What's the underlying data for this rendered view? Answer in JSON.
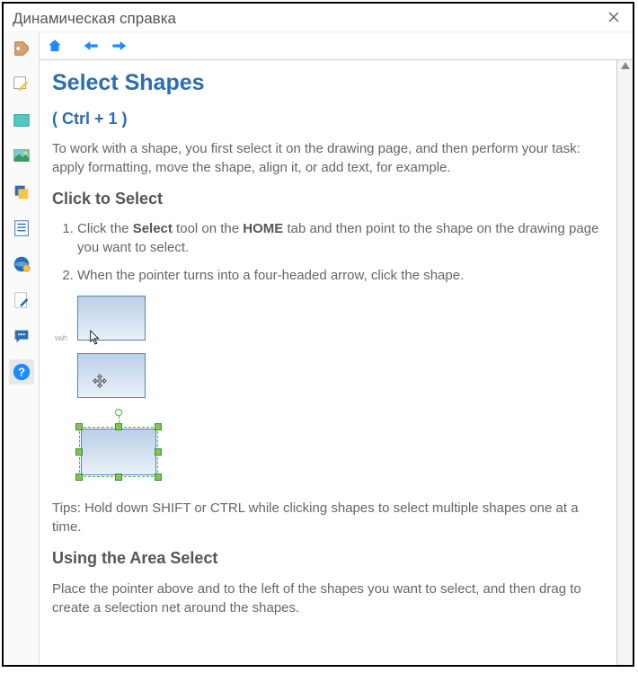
{
  "window": {
    "title": "Динамическая справка"
  },
  "sidebar": {
    "items": [
      {
        "name": "tag-icon"
      },
      {
        "name": "edit-icon"
      },
      {
        "name": "shape-icon"
      },
      {
        "name": "image-icon"
      },
      {
        "name": "layers-icon"
      },
      {
        "name": "list-icon"
      },
      {
        "name": "globe-icon"
      },
      {
        "name": "page-edit-icon"
      },
      {
        "name": "chat-icon"
      },
      {
        "name": "help-icon"
      }
    ]
  },
  "toolbar": {
    "home": "home",
    "back": "back",
    "forward": "forward"
  },
  "topic": {
    "title": "Select Shapes",
    "shortcut": "( Ctrl + 1 )",
    "intro": "To work with a shape, you first select it on the drawing page, and then perform your task: apply formatting, move the shape, align it, or add text, for example.",
    "section1_title": "Click to Select",
    "step1_pre": "Click the ",
    "step1_b1": "Select",
    "step1_mid": " tool on the ",
    "step1_b2": "HOME",
    "step1_post": " tab and then point to the shape on the drawing page you want to select.",
    "step2": "When the pointer turns into a four-headed arrow, click the shape.",
    "tips": "Tips: Hold down SHIFT or CTRL while clicking shapes to select multiple shapes one at a time.",
    "section2_title": "Using the Area Select",
    "section2_body": "Place the pointer above and to the left of the shapes you want to select, and then drag to create a selection net around the shapes."
  }
}
